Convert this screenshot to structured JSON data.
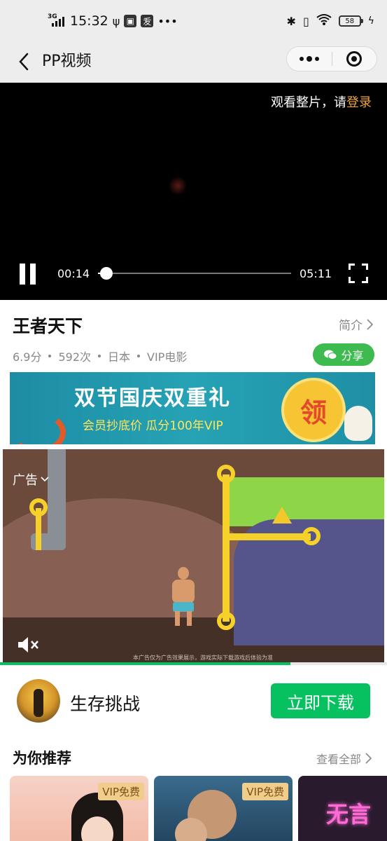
{
  "status_bar": {
    "network": "3G",
    "time": "15:32",
    "extra_icons": [
      "usb-icon",
      "app-icon",
      "app-icon",
      "more-icon"
    ],
    "battery": "58"
  },
  "nav": {
    "title": "PP视频",
    "menu_icon": "more-dots-icon",
    "close_icon": "target-icon"
  },
  "player": {
    "login_hint_prefix": "观看整片，请",
    "login_link": "登录",
    "current_time": "00:14",
    "duration": "05:11",
    "progress_fraction": 0.045
  },
  "movie": {
    "title": "王者天下",
    "intro_label": "简介",
    "meta": [
      "6.9分",
      "592次",
      "日本",
      "VIP电影"
    ],
    "share_label": "分享"
  },
  "banner": {
    "title": "双节国庆双重礼",
    "subtitle": "会员抄底价  瓜分100年VIP",
    "badge": "领"
  },
  "ad": {
    "label": "广告",
    "caption": "本广告仅为广告效果展示，游戏实际下载游戏后体验为准",
    "progress_fraction": 0.75
  },
  "app": {
    "name": "生存挑战",
    "download_label": "立即下载"
  },
  "recommend": {
    "title": "为你推荐",
    "more_label": "查看全部",
    "cards": [
      {
        "badge": "VIP免费"
      },
      {
        "badge": "VIP免费"
      },
      {
        "text": "无言"
      }
    ]
  },
  "colors": {
    "accent_green": "#07c160",
    "share_green": "#3dbb4f",
    "login_orange": "#f0a23c",
    "vip_badge": "#f0cd8a"
  }
}
